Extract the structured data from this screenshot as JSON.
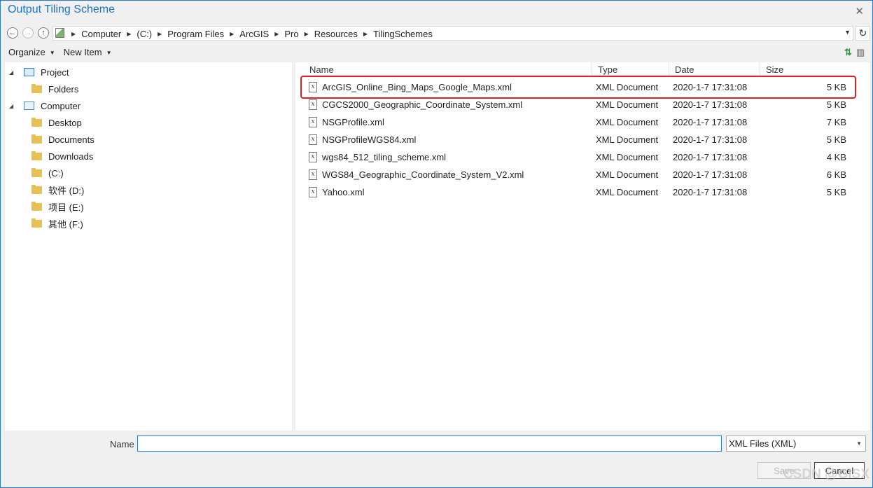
{
  "window": {
    "title": "Output Tiling Scheme",
    "close_glyph": "✕"
  },
  "nav_buttons": {
    "back": "←",
    "forward": "→",
    "up": "↑"
  },
  "address": {
    "crumbs": [
      "Computer",
      "(C:)",
      "Program Files",
      "ArcGIS",
      "Pro",
      "Resources",
      "TilingSchemes"
    ],
    "refresh_glyph": "↻"
  },
  "toolbar": {
    "organize": "Organize",
    "new_item": "New Item",
    "sort_glyph": "⇅",
    "view_glyph": "▥"
  },
  "sidebar": {
    "items": [
      {
        "label": "Project",
        "icon": "project-icon",
        "expander": "◢"
      },
      {
        "label": "Folders",
        "icon": "folder-icon"
      },
      {
        "label": "Computer",
        "icon": "computer-icon",
        "expander": "◢"
      },
      {
        "label": "Desktop",
        "icon": "folder-icon"
      },
      {
        "label": "Documents",
        "icon": "folder-icon"
      },
      {
        "label": "Downloads",
        "icon": "folder-icon"
      },
      {
        "label": " (C:)",
        "icon": "folder-icon"
      },
      {
        "label": "软件 (D:)",
        "icon": "folder-icon"
      },
      {
        "label": "项目 (E:)",
        "icon": "folder-icon"
      },
      {
        "label": "其他 (F:)",
        "icon": "folder-icon"
      }
    ]
  },
  "file_list": {
    "columns": [
      "Name",
      "Type",
      "Date",
      "Size"
    ],
    "files": [
      {
        "name": "ArcGIS_Online_Bing_Maps_Google_Maps.xml",
        "type": "XML Document",
        "date": "2020-1-7 17:31:08",
        "size": "5 KB",
        "highlighted": true
      },
      {
        "name": "CGCS2000_Geographic_Coordinate_System.xml",
        "type": "XML Document",
        "date": "2020-1-7 17:31:08",
        "size": "5 KB"
      },
      {
        "name": "NSGProfile.xml",
        "type": "XML Document",
        "date": "2020-1-7 17:31:08",
        "size": "7 KB"
      },
      {
        "name": "NSGProfileWGS84.xml",
        "type": "XML Document",
        "date": "2020-1-7 17:31:08",
        "size": "5 KB"
      },
      {
        "name": "wgs84_512_tiling_scheme.xml",
        "type": "XML Document",
        "date": "2020-1-7 17:31:08",
        "size": "4 KB"
      },
      {
        "name": "WGS84_Geographic_Coordinate_System_V2.xml",
        "type": "XML Document",
        "date": "2020-1-7 17:31:08",
        "size": "6 KB"
      },
      {
        "name": "Yahoo.xml",
        "type": "XML Document",
        "date": "2020-1-7 17:31:08",
        "size": "5 KB"
      }
    ]
  },
  "footer": {
    "name_label": "Name",
    "name_value": "",
    "filetype": "XML Files (XML)",
    "save_label": "Save",
    "cancel_label": "Cancel"
  },
  "watermark": "CSDN @GISX",
  "colors": {
    "accent": "#2b79c9",
    "highlight_border": "#e02020",
    "folder": "#e8c156"
  }
}
